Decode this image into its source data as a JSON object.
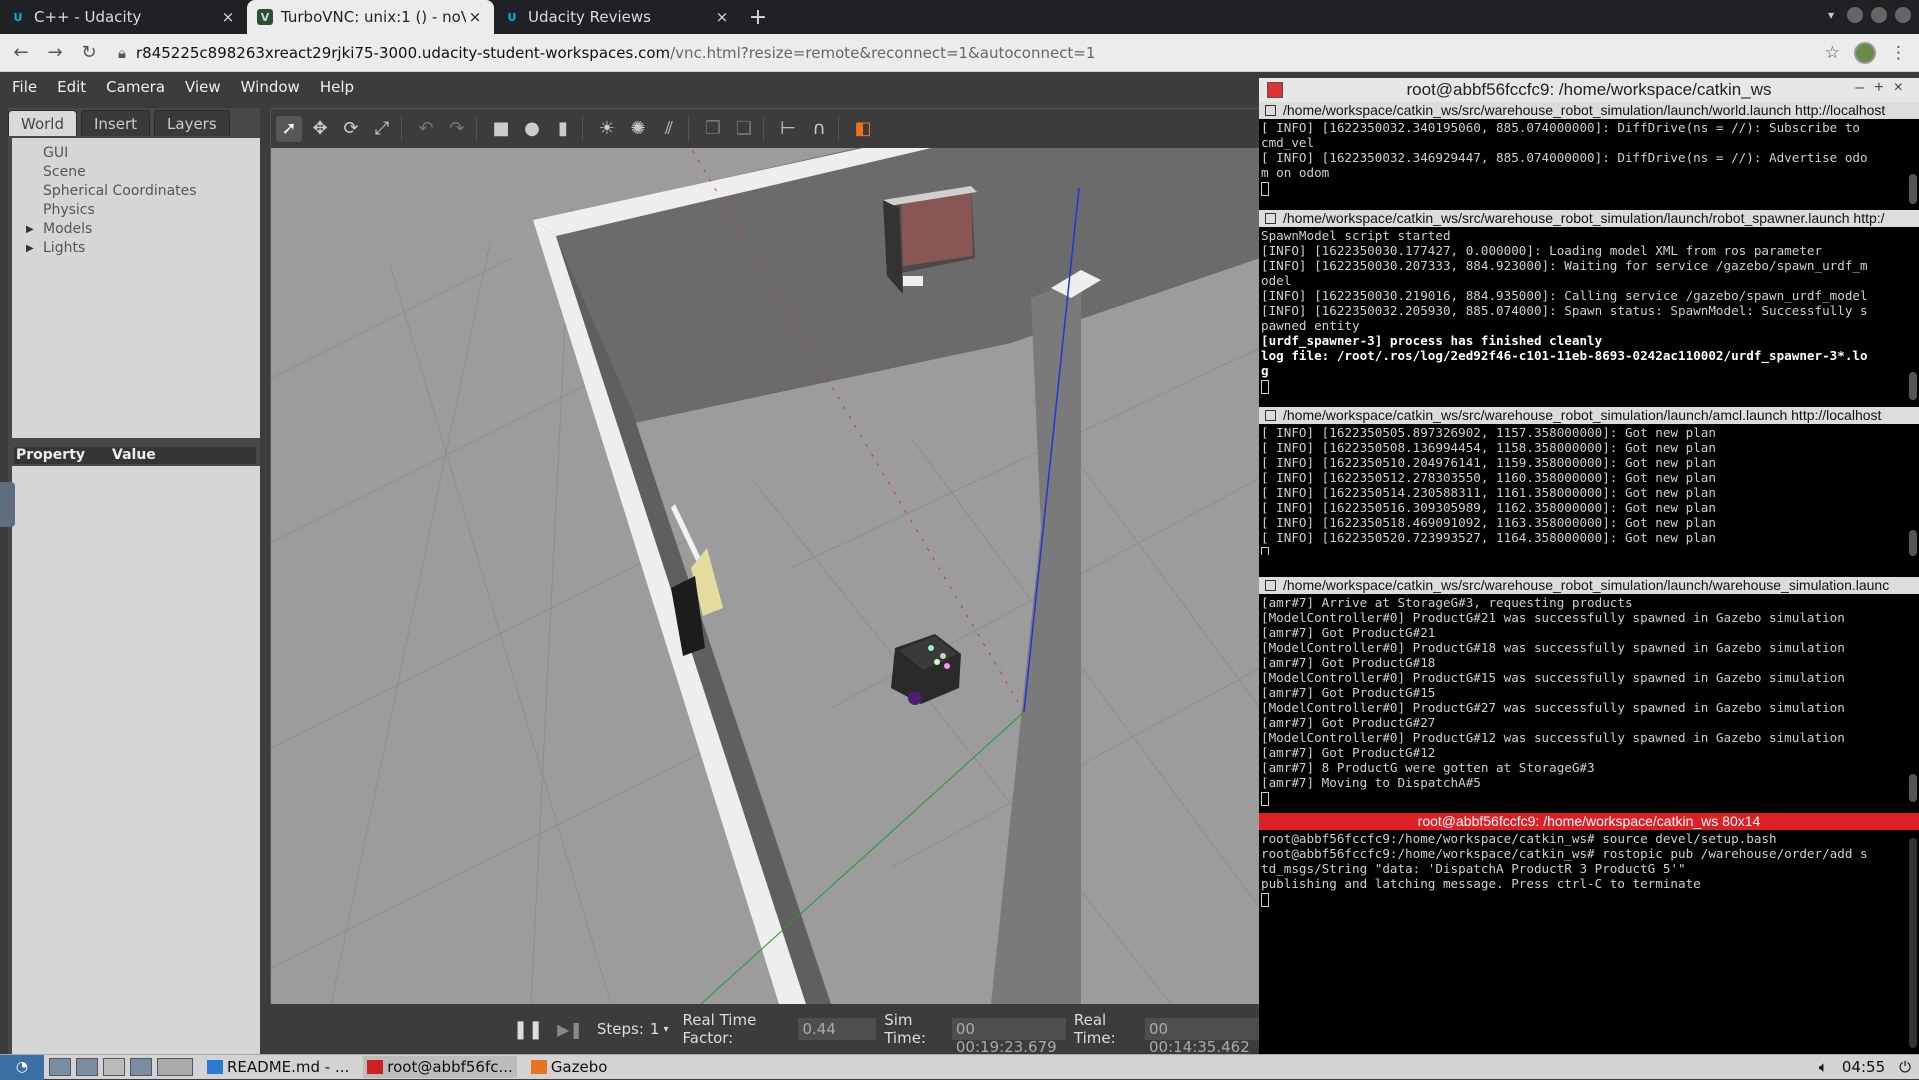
{
  "browser": {
    "tabs": [
      {
        "title": "C++ - Udacity",
        "icon": "udacity-icon",
        "active": false
      },
      {
        "title": "TurboVNC: unix:1 () - noVNC",
        "icon": "vnc-icon",
        "active": true
      },
      {
        "title": "Udacity Reviews",
        "icon": "udacity-icon",
        "active": false
      }
    ],
    "new_tab": "+",
    "url_host": "r845225c898263xreact29rjki75-3000.udacity-student-workspaces.com",
    "url_path": "/vnc.html?resize=remote&reconnect=1&autoconnect=1"
  },
  "gazebo": {
    "menu": [
      "File",
      "Edit",
      "Camera",
      "View",
      "Window",
      "Help"
    ],
    "left_tabs": [
      "World",
      "Insert",
      "Layers"
    ],
    "tree": [
      "GUI",
      "Scene",
      "Spherical Coordinates",
      "Physics",
      "Models",
      "Lights"
    ],
    "property_header": {
      "property": "Property",
      "value": "Value"
    },
    "bottom": {
      "steps_label": "Steps:",
      "steps_value": "1",
      "rtf_label": "Real Time Factor:",
      "rtf_value": "0.44",
      "sim_label": "Sim Time:",
      "sim_value": "00 00:19:23.679",
      "real_label": "Real Time:",
      "real_value": "00 00:14:35.462"
    }
  },
  "terminal": {
    "title": "root@abbf56fccfc9: /home/workspace/catkin_ws",
    "panes": [
      {
        "header": "/home/workspace/catkin_ws/src/warehouse_robot_simulation/launch/world.launch http://localhost",
        "lines": [
          {
            "t": "[ INFO] [1622350032.340195060, 885.074000000]: DiffDrive(ns = //): Subscribe to"
          },
          {
            "t": "cmd_vel"
          },
          {
            "t": "[ INFO] [1622350032.346929447, 885.074000000]: DiffDrive(ns = //): Advertise odo"
          },
          {
            "t": "m on odom"
          }
        ]
      },
      {
        "header": "/home/workspace/catkin_ws/src/warehouse_robot_simulation/launch/robot_spawner.launch http:/",
        "lines": [
          {
            "t": "SpawnModel script started"
          },
          {
            "t": "[INFO] [1622350030.177427, 0.000000]: Loading model XML from ros parameter"
          },
          {
            "t": "[INFO] [1622350030.207333, 884.923000]: Waiting for service /gazebo/spawn_urdf_m"
          },
          {
            "t": "odel"
          },
          {
            "t": "[INFO] [1622350030.219016, 884.935000]: Calling service /gazebo/spawn_urdf_model"
          },
          {
            "t": "[INFO] [1622350032.205930, 885.074000]: Spawn status: SpawnModel: Successfully s"
          },
          {
            "t": "pawned entity"
          },
          {
            "t": "[urdf_spawner-3] process has finished cleanly",
            "bold": true
          },
          {
            "t": "log file: /root/.ros/log/2ed92f46-c101-11eb-8693-0242ac110002/urdf_spawner-3*.lo",
            "bold": true
          },
          {
            "t": "g",
            "bold": true
          }
        ]
      },
      {
        "header": "/home/workspace/catkin_ws/src/warehouse_robot_simulation/launch/amcl.launch http://localhost",
        "lines": [
          {
            "t": "[ INFO] [1622350505.897326902, 1157.358000000]: Got new plan"
          },
          {
            "t": "[ INFO] [1622350508.136994454, 1158.358000000]: Got new plan"
          },
          {
            "t": "[ INFO] [1622350510.204976141, 1159.358000000]: Got new plan"
          },
          {
            "t": "[ INFO] [1622350512.278303550, 1160.358000000]: Got new plan"
          },
          {
            "t": "[ INFO] [1622350514.230588311, 1161.358000000]: Got new plan"
          },
          {
            "t": "[ INFO] [1622350516.309305989, 1162.358000000]: Got new plan"
          },
          {
            "t": "[ INFO] [1622350518.469091092, 1163.358000000]: Got new plan"
          },
          {
            "t": "[ INFO] [1622350520.723993527, 1164.358000000]: Got new plan"
          }
        ]
      },
      {
        "header": "/home/workspace/catkin_ws/src/warehouse_robot_simulation/launch/warehouse_simulation.launc",
        "lines": [
          {
            "t": "[amr#7] Arrive at StorageG#3, requesting products"
          },
          {
            "t": "[ModelController#0] ProductG#21 was successfully spawned in Gazebo simulation"
          },
          {
            "t": "[amr#7] Got ProductG#21"
          },
          {
            "t": "[ModelController#0] ProductG#18 was successfully spawned in Gazebo simulation"
          },
          {
            "t": "[amr#7] Got ProductG#18"
          },
          {
            "t": "[ModelController#0] ProductG#15 was successfully spawned in Gazebo simulation"
          },
          {
            "t": "[amr#7] Got ProductG#15"
          },
          {
            "t": "[ModelController#0] ProductG#27 was successfully spawned in Gazebo simulation"
          },
          {
            "t": "[amr#7] Got ProductG#27"
          },
          {
            "t": "[ModelController#0] ProductG#12 was successfully spawned in Gazebo simulation"
          },
          {
            "t": "[amr#7] Got ProductG#12"
          },
          {
            "t": "[amr#7] 8 ProductG were gotten at StorageG#3"
          },
          {
            "t": "[amr#7] Moving to DispatchA#5"
          }
        ]
      },
      {
        "header": "root@abbf56fccfc9: /home/workspace/catkin_ws 80x14",
        "lines": [
          {
            "t": "root@abbf56fccfc9:/home/workspace/catkin_ws# source devel/setup.bash"
          },
          {
            "t": "root@abbf56fccfc9:/home/workspace/catkin_ws# rostopic pub /warehouse/order/add s"
          },
          {
            "t": "td_msgs/String \"data: 'DispatchA ProductR 3 ProductG 5'\""
          },
          {
            "t": "publishing and latching message. Press ctrl-C to terminate"
          }
        ]
      }
    ]
  },
  "taskbar": {
    "tasks": [
      "README.md - ...",
      "root@abbf56fc...",
      "Gazebo"
    ],
    "clock": "04:55"
  },
  "colors": {
    "terminal_active_header": "#dd1f26",
    "gazebo_panel": "#3c3c3c",
    "orange_accent": "#e8741f"
  }
}
